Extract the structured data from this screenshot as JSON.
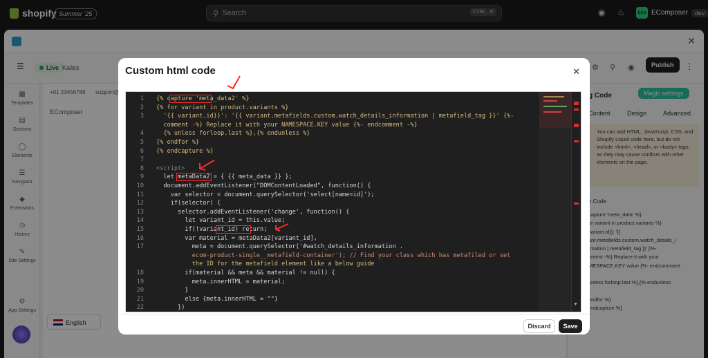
{
  "topbar": {
    "brand": "shopify",
    "edition": "Summer '25",
    "search_placeholder": "Search",
    "kbd_ctrl": "CTRL",
    "kbd_k": "K",
    "store_avatar": "ECo",
    "store_name": "EComposer",
    "store_badge": "dev"
  },
  "app": {
    "status": "Live",
    "page_name": "Kalles",
    "publish_label": "Publish",
    "canvas_label": "EComposer",
    "phone": "+01 23456789",
    "email_partial": "support@",
    "language": "English",
    "sidebar": [
      {
        "label": "Templates",
        "icon": "templates-icon"
      },
      {
        "label": "Sections",
        "icon": "sections-icon"
      },
      {
        "label": "Elements",
        "icon": "elements-icon"
      },
      {
        "label": "Navigator",
        "icon": "navigator-icon"
      },
      {
        "label": "Extensions",
        "icon": "extensions-icon"
      },
      {
        "label": "History",
        "icon": "history-icon"
      },
      {
        "label": "Site Settings",
        "icon": "site-settings-icon"
      },
      {
        "label": "App Settings",
        "icon": "app-settings-icon"
      }
    ]
  },
  "rightpanel": {
    "title_partial": "g Code",
    "magic_label": "Magic settings",
    "tabs": [
      "Content",
      "Design",
      "Advanced"
    ],
    "info": "You can add HTML, JavaScript, CSS, and Shopify Liquid code here, but do not include <html>, <head>, or <body> tags, as they may cause conflicts with other elements on the page.",
    "section_label": "n Code",
    "code_preview": [
      "capture 'meta_data' %}",
      "or variant in product.variants %}",
      "variant.id}}: '{{",
      "ant.metafields.custom.watch_details_i",
      "rmation | metafield_tag }}' {%-",
      "nment -%} Replace it with your",
      "MESPACE.KEY value {%- endcomment",
      "",
      "unless forloop.last %},{% endunless",
      "",
      "endfor %}",
      "endcapture %}"
    ]
  },
  "modal": {
    "title": "Custom html code",
    "discard_label": "Discard",
    "save_label": "Save"
  },
  "code_lines": [
    {
      "n": "1",
      "text": "{% capture 'meta_data2' %}"
    },
    {
      "n": "2",
      "text": "{% for variant in product.variants %}"
    },
    {
      "n": "3",
      "text": "  '{{ variant.id}}': '{{ variant.metafields.custom.watch_details_information | metafield_tag }}' {%-"
    },
    {
      "n": "",
      "text": "  comment -%} Replace it with your NAMESPACE.KEY value {%- endcomment -%}"
    },
    {
      "n": "4",
      "text": "  {% unless forloop.last %},{% endunless %}"
    },
    {
      "n": "5",
      "text": "{% endfor %}"
    },
    {
      "n": "6",
      "text": "{% endcapture %}"
    },
    {
      "n": "7",
      "text": ""
    },
    {
      "n": "8",
      "text": "<script>"
    },
    {
      "n": "9",
      "text": "  let metaData2 = { {{ meta_data }} };"
    },
    {
      "n": "10",
      "text": "  document.addEventListener(\"DOMContentLoaded\", function() {"
    },
    {
      "n": "11",
      "text": "    var selector = document.querySelector('select[name=id]');"
    },
    {
      "n": "12",
      "text": "    if(selector) {"
    },
    {
      "n": "13",
      "text": "      selector.addEventListener('change', function() {"
    },
    {
      "n": "14",
      "text": "        let variant_id = this.value;"
    },
    {
      "n": "15",
      "text": "        if(!variant_id) return;"
    },
    {
      "n": "16",
      "text": "        var material = metaData2[variant_id],"
    },
    {
      "n": "17",
      "text": "          meta = document.querySelector('#watch_details_information ."
    },
    {
      "n": "",
      "text": "          ecom-product-single__metafield-container'); // Find your class which has metafiled or set"
    },
    {
      "n": "",
      "text": "          the ID for the metafield element like a below guide"
    },
    {
      "n": "18",
      "text": "        if(material && meta && material != null) {"
    },
    {
      "n": "19",
      "text": "          meta.innerHTML = material;"
    },
    {
      "n": "20",
      "text": "        }"
    },
    {
      "n": "21",
      "text": "        else {meta.innerHTML = \"\"}"
    },
    {
      "n": "22",
      "text": "      })"
    }
  ]
}
